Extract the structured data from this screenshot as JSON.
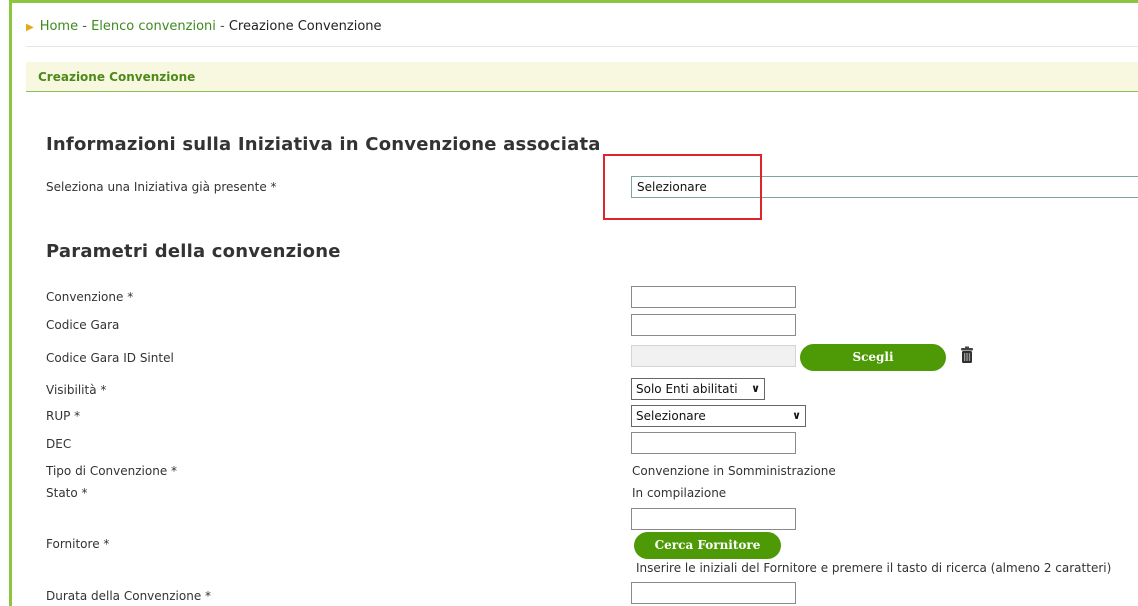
{
  "breadcrumb": {
    "home": "Home",
    "sep1": " - ",
    "list": "Elenco convenzioni",
    "sep2": " - ",
    "current": "Creazione Convenzione"
  },
  "section_bar": "Creazione Convenzione",
  "initiative": {
    "heading": "Informazioni sulla Iniziativa in Convenzione associata",
    "label": "Seleziona una Iniziativa già presente *",
    "value": "Selezionare"
  },
  "params": {
    "heading": "Parametri della convenzione",
    "convenzione_label": "Convenzione *",
    "codice_gara_label": "Codice Gara",
    "codice_gara_sintel_label": "Codice Gara ID Sintel",
    "scegli_button": "Scegli",
    "visibilita_label": "Visibilità *",
    "visibilita_value": "Solo Enti abilitati",
    "rup_label": "RUP *",
    "rup_value": "Selezionare",
    "dec_label": "DEC",
    "tipo_label": "Tipo di Convenzione *",
    "tipo_value": "Convenzione in Somministrazione",
    "stato_label": "Stato *",
    "stato_value": "In compilazione",
    "fornitore_label": "Fornitore *",
    "cerca_fornitore_button": "Cerca Fornitore",
    "fornitore_hint": "Inserire le iniziali del Fornitore e premere il tasto di ricerca (almeno 2 caratteri)",
    "durata_label": "Durata della Convenzione *"
  },
  "colors": {
    "accent_green": "#4e9a06",
    "frame_green": "#8cc63f",
    "highlight_red": "#e0242b"
  }
}
